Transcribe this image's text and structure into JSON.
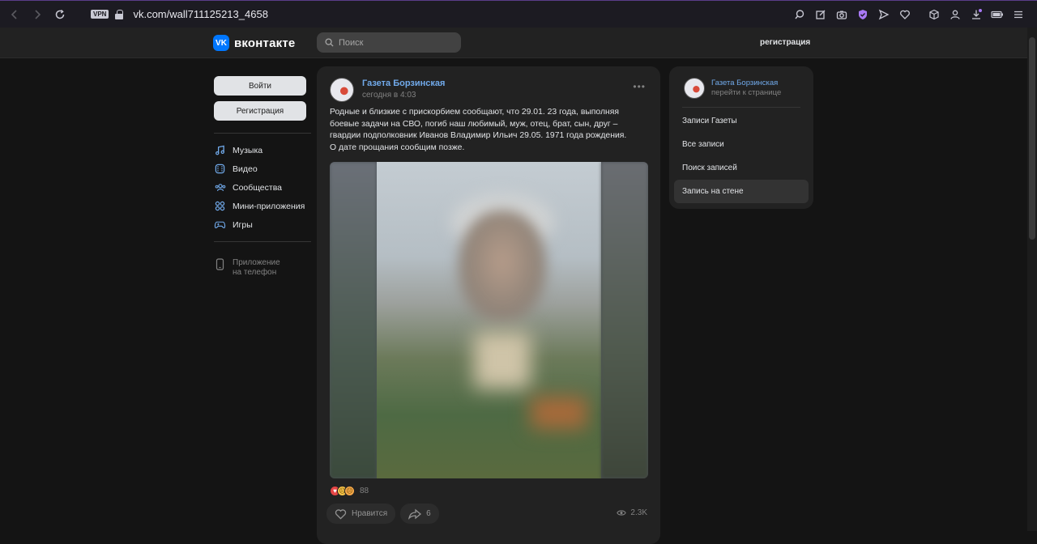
{
  "browser": {
    "url": "vk.com/wall711125213_4658",
    "vpn_label": "VPN"
  },
  "header": {
    "logo_mark": "VK",
    "logo_text": "вконтакте",
    "search_placeholder": "Поиск",
    "register_link": "регистрация"
  },
  "sidebar": {
    "login_button": "Войти",
    "register_button": "Регистрация",
    "items": [
      {
        "label": "Музыка",
        "icon": "music-icon"
      },
      {
        "label": "Видео",
        "icon": "video-icon"
      },
      {
        "label": "Сообщества",
        "icon": "communities-icon"
      },
      {
        "label": "Мини-приложения",
        "icon": "mini-apps-icon"
      },
      {
        "label": "Игры",
        "icon": "games-icon"
      }
    ],
    "app_line1": "Приложение",
    "app_line2": "на телефон"
  },
  "post": {
    "author": "Газета Борзинская",
    "time": "сегодня в 4:03",
    "more": "•••",
    "text_line1": "Родные и близкие с прискорбием сообщают, что 29.01. 23 года, выполняя боевые задачи на СВО, погиб наш любимый, муж, отец, брат, сын, друг – гвардии подполковник Иванов Владимир Ильич 29.05. 1971 года рождения.",
    "text_line2": "О дате прощания сообщим позже.",
    "reactions_count": "88",
    "like_label": "Нравится",
    "share_count": "6",
    "views": "2.3K"
  },
  "right_panel": {
    "name": "Газета Борзинская",
    "subtitle": "перейти к странице",
    "menu": [
      {
        "label": "Записи Газеты",
        "active": false
      },
      {
        "label": "Все записи",
        "active": false
      },
      {
        "label": "Поиск записей",
        "active": false
      },
      {
        "label": "Запись на стене",
        "active": true
      }
    ]
  },
  "colors": {
    "accent_link": "#71aaeb",
    "vk_blue": "#0077ff",
    "background": "#141414",
    "card": "#222222"
  }
}
